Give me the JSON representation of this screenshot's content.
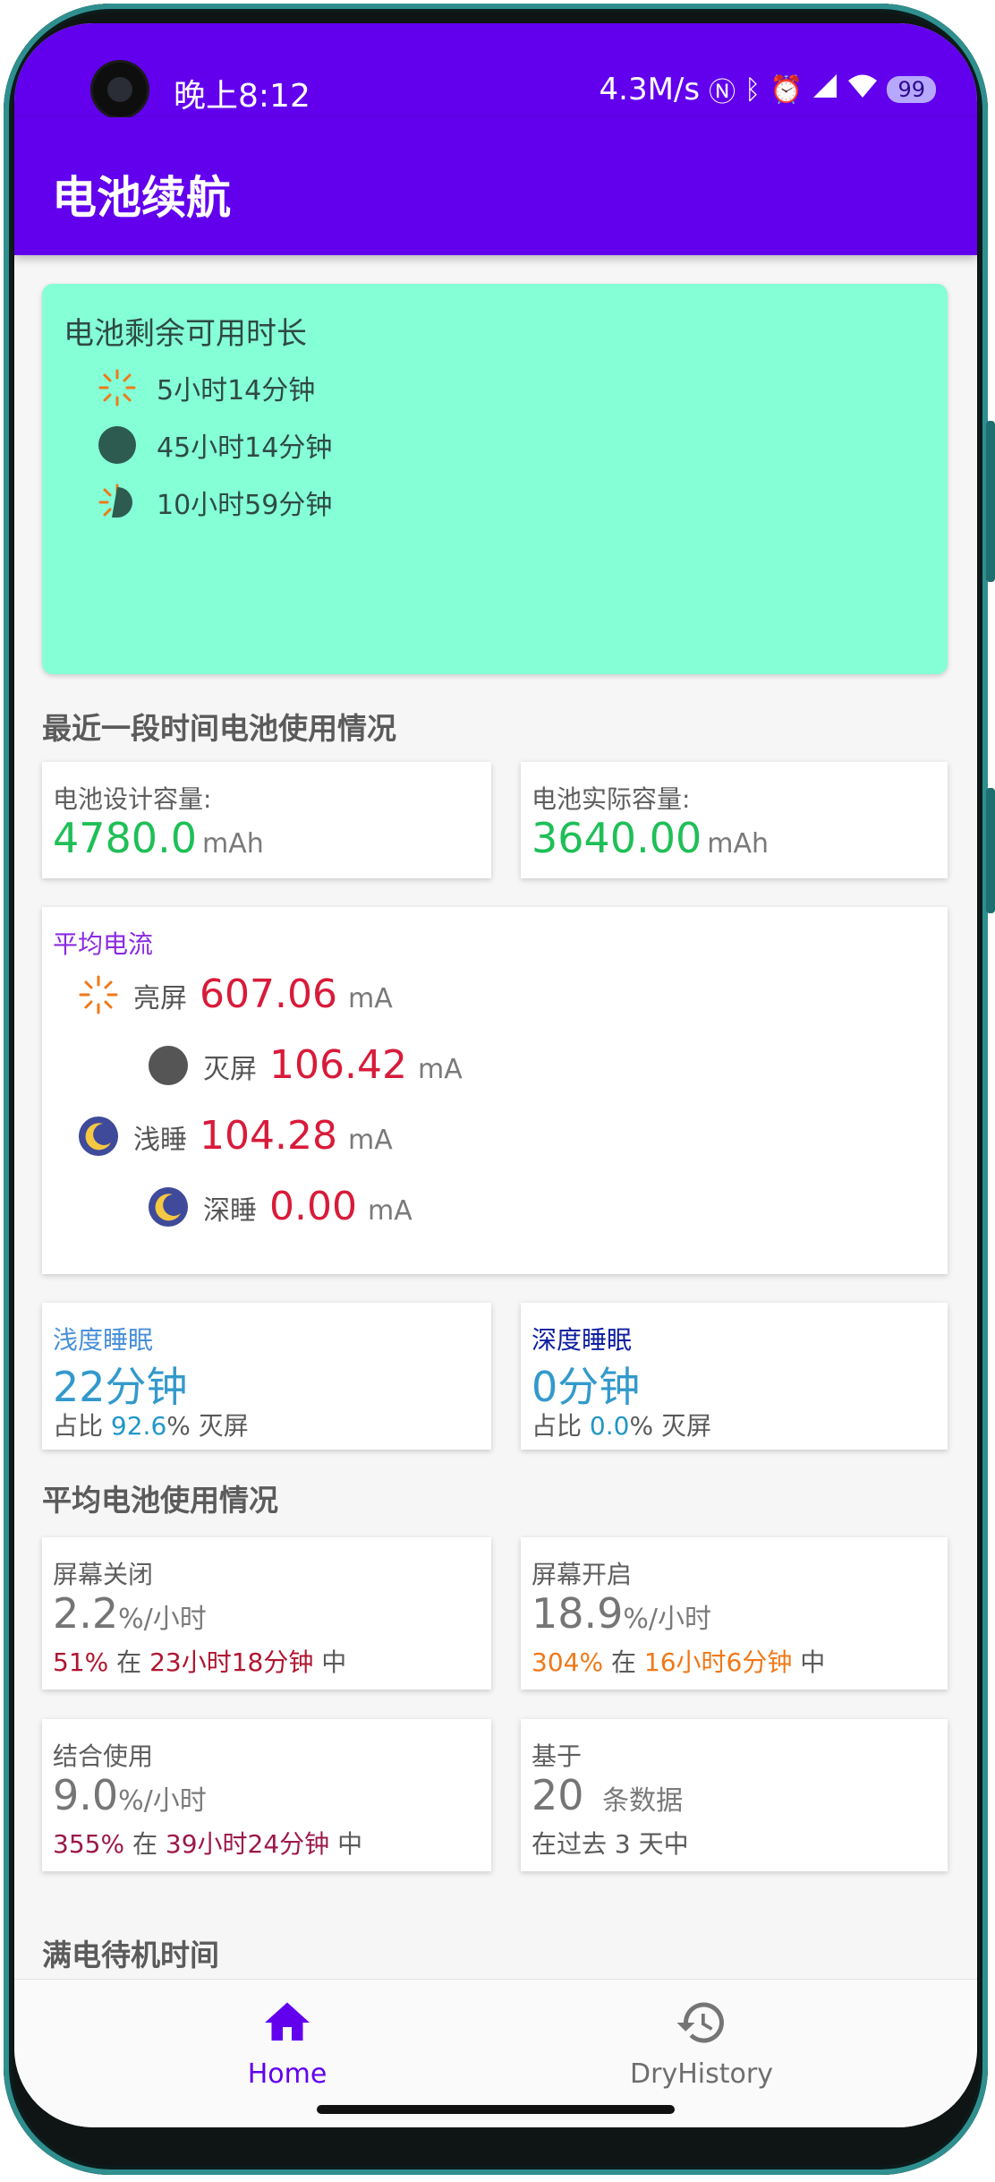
{
  "status_bar": {
    "time": "晚上8:12",
    "net_speed": "4.3M/s",
    "battery_level": "99"
  },
  "app_bar": {
    "title": "电池续航"
  },
  "remaining": {
    "title": "电池剩余可用时长",
    "screen_on": "5小时14分钟",
    "screen_off": "45小时14分钟",
    "mixed": "10小时59分钟"
  },
  "recent_section": {
    "title": "最近一段时间电池使用情况"
  },
  "capacity": {
    "design_label": "电池设计容量:",
    "design_value": "4780.0",
    "actual_label": "电池实际容量:",
    "actual_value": "3640.00",
    "unit": "mAh"
  },
  "avg_current": {
    "title": "平均电流",
    "unit": "mA",
    "rows": [
      {
        "label": "亮屏",
        "value": "607.06"
      },
      {
        "label": "灭屏",
        "value": "106.42"
      },
      {
        "label": "浅睡",
        "value": "104.28"
      },
      {
        "label": "深睡",
        "value": "0.00"
      }
    ]
  },
  "sleep": {
    "light": {
      "title": "浅度睡眠",
      "value": "22分钟",
      "ratio_prefix": "占比",
      "ratio": "92.6",
      "ratio_suffix": "% 灭屏"
    },
    "deep": {
      "title": "深度睡眠",
      "value": "0分钟",
      "ratio_prefix": "占比",
      "ratio": "0.0",
      "ratio_suffix": "% 灭屏"
    }
  },
  "avg_section": {
    "title": "平均电池使用情况"
  },
  "avg_usage": {
    "per_hour_unit": "%/小时",
    "in_word": "在",
    "mid_word": "中",
    "screen_off": {
      "title": "屏幕关闭",
      "rate": "2.2",
      "pct": "51%",
      "duration": "23小时18分钟"
    },
    "screen_on": {
      "title": "屏幕开启",
      "rate": "18.9",
      "pct": "304%",
      "duration": "16小时6分钟"
    },
    "combined": {
      "title": "结合使用",
      "rate": "9.0",
      "pct": "355%",
      "duration": "39小时24分钟"
    },
    "based_on": {
      "title": "基于",
      "count": "20",
      "count_unit": "条数据",
      "period": "在过去 3 天中"
    }
  },
  "standby_section": {
    "title": "满电待机时间"
  },
  "bottom_nav": {
    "home_label": "Home",
    "history_label": "DryHistory"
  },
  "colors": {
    "primary": "#6200ee",
    "remaining_card": "#84ffd6",
    "accent_green": "#1fbf57",
    "accent_red": "#d81b3a"
  }
}
